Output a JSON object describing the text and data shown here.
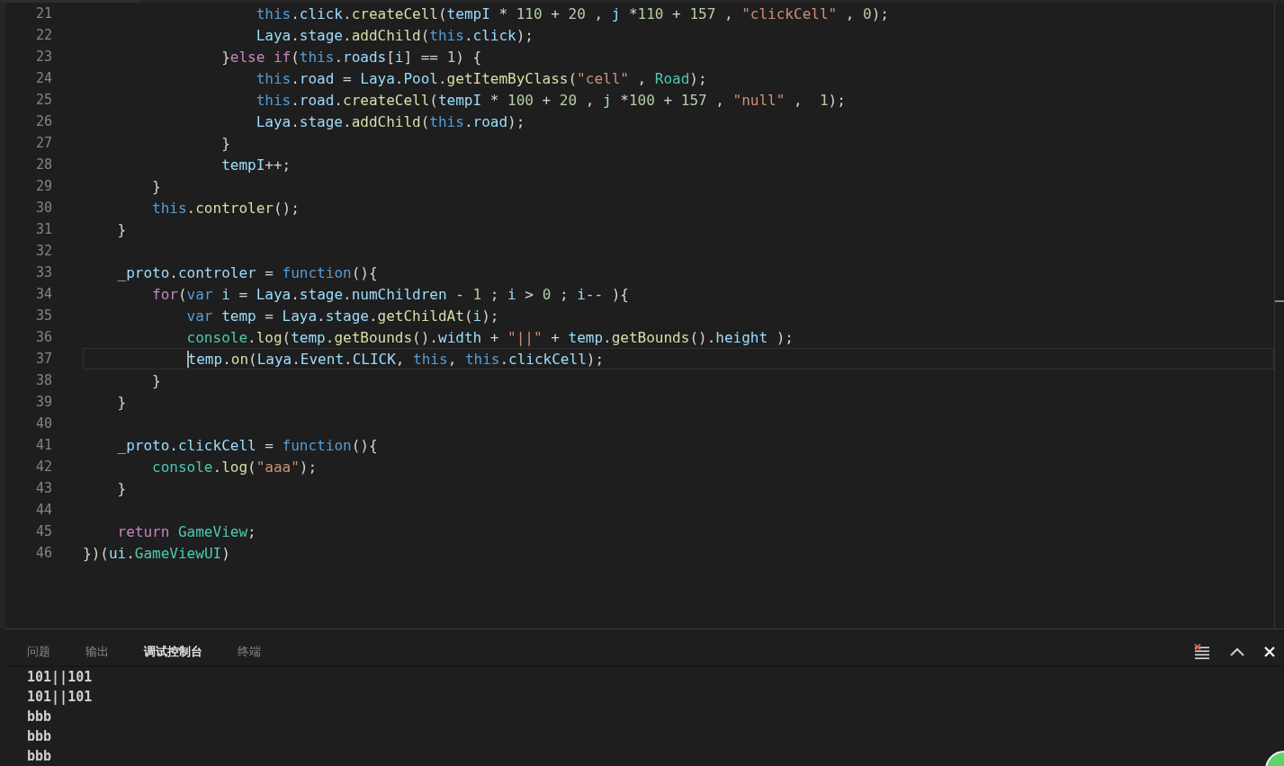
{
  "editor": {
    "lines": [
      {
        "number": "21",
        "current": false,
        "tokens": [
          {
            "kind": "kw",
            "t": "                    this"
          },
          {
            "kind": "p",
            "t": "."
          },
          {
            "kind": "var",
            "t": "click"
          },
          {
            "kind": "p",
            "t": "."
          },
          {
            "kind": "fn",
            "t": "createCell"
          },
          {
            "kind": "p",
            "t": "("
          },
          {
            "kind": "var",
            "t": "tempI"
          },
          {
            "kind": "p",
            "t": " * "
          },
          {
            "kind": "num",
            "t": "110"
          },
          {
            "kind": "p",
            "t": " + "
          },
          {
            "kind": "num",
            "t": "20"
          },
          {
            "kind": "p",
            "t": " , "
          },
          {
            "kind": "var",
            "t": "j"
          },
          {
            "kind": "p",
            "t": " *"
          },
          {
            "kind": "num",
            "t": "110"
          },
          {
            "kind": "p",
            "t": " + "
          },
          {
            "kind": "num",
            "t": "157"
          },
          {
            "kind": "p",
            "t": " , "
          },
          {
            "kind": "str",
            "t": "\"clickCell\""
          },
          {
            "kind": "p",
            "t": " , "
          },
          {
            "kind": "num",
            "t": "0"
          },
          {
            "kind": "p",
            "t": ");"
          }
        ]
      },
      {
        "number": "22",
        "current": false,
        "tokens": [
          {
            "kind": "var",
            "t": "                    Laya"
          },
          {
            "kind": "p",
            "t": "."
          },
          {
            "kind": "var",
            "t": "stage"
          },
          {
            "kind": "p",
            "t": "."
          },
          {
            "kind": "fn",
            "t": "addChild"
          },
          {
            "kind": "p",
            "t": "("
          },
          {
            "kind": "kw",
            "t": "this"
          },
          {
            "kind": "p",
            "t": "."
          },
          {
            "kind": "var",
            "t": "click"
          },
          {
            "kind": "p",
            "t": ");"
          }
        ]
      },
      {
        "number": "23",
        "current": false,
        "tokens": [
          {
            "kind": "p",
            "t": "                }"
          },
          {
            "kind": "ctl",
            "t": "else if"
          },
          {
            "kind": "p",
            "t": "("
          },
          {
            "kind": "kw",
            "t": "this"
          },
          {
            "kind": "p",
            "t": "."
          },
          {
            "kind": "var",
            "t": "roads"
          },
          {
            "kind": "p",
            "t": "["
          },
          {
            "kind": "var",
            "t": "i"
          },
          {
            "kind": "p",
            "t": "] == "
          },
          {
            "kind": "num",
            "t": "1"
          },
          {
            "kind": "p",
            "t": ") {"
          }
        ]
      },
      {
        "number": "24",
        "current": false,
        "tokens": [
          {
            "kind": "kw",
            "t": "                    this"
          },
          {
            "kind": "p",
            "t": "."
          },
          {
            "kind": "var",
            "t": "road"
          },
          {
            "kind": "p",
            "t": " = "
          },
          {
            "kind": "var",
            "t": "Laya"
          },
          {
            "kind": "p",
            "t": "."
          },
          {
            "kind": "var",
            "t": "Pool"
          },
          {
            "kind": "p",
            "t": "."
          },
          {
            "kind": "fn",
            "t": "getItemByClass"
          },
          {
            "kind": "p",
            "t": "("
          },
          {
            "kind": "str",
            "t": "\"cell\""
          },
          {
            "kind": "p",
            "t": " , "
          },
          {
            "kind": "type",
            "t": "Road"
          },
          {
            "kind": "p",
            "t": ");"
          }
        ]
      },
      {
        "number": "25",
        "current": false,
        "tokens": [
          {
            "kind": "kw",
            "t": "                    this"
          },
          {
            "kind": "p",
            "t": "."
          },
          {
            "kind": "var",
            "t": "road"
          },
          {
            "kind": "p",
            "t": "."
          },
          {
            "kind": "fn",
            "t": "createCell"
          },
          {
            "kind": "p",
            "t": "("
          },
          {
            "kind": "var",
            "t": "tempI"
          },
          {
            "kind": "p",
            "t": " * "
          },
          {
            "kind": "num",
            "t": "100"
          },
          {
            "kind": "p",
            "t": " + "
          },
          {
            "kind": "num",
            "t": "20"
          },
          {
            "kind": "p",
            "t": " , "
          },
          {
            "kind": "var",
            "t": "j"
          },
          {
            "kind": "p",
            "t": " *"
          },
          {
            "kind": "num",
            "t": "100"
          },
          {
            "kind": "p",
            "t": " + "
          },
          {
            "kind": "num",
            "t": "157"
          },
          {
            "kind": "p",
            "t": " , "
          },
          {
            "kind": "str",
            "t": "\"null\""
          },
          {
            "kind": "p",
            "t": " ,  "
          },
          {
            "kind": "num",
            "t": "1"
          },
          {
            "kind": "p",
            "t": ");"
          }
        ]
      },
      {
        "number": "26",
        "current": false,
        "tokens": [
          {
            "kind": "var",
            "t": "                    Laya"
          },
          {
            "kind": "p",
            "t": "."
          },
          {
            "kind": "var",
            "t": "stage"
          },
          {
            "kind": "p",
            "t": "."
          },
          {
            "kind": "fn",
            "t": "addChild"
          },
          {
            "kind": "p",
            "t": "("
          },
          {
            "kind": "kw",
            "t": "this"
          },
          {
            "kind": "p",
            "t": "."
          },
          {
            "kind": "var",
            "t": "road"
          },
          {
            "kind": "p",
            "t": ");"
          }
        ]
      },
      {
        "number": "27",
        "current": false,
        "tokens": [
          {
            "kind": "p",
            "t": "                }"
          }
        ]
      },
      {
        "number": "28",
        "current": false,
        "tokens": [
          {
            "kind": "var",
            "t": "                tempI"
          },
          {
            "kind": "p",
            "t": "++;"
          }
        ]
      },
      {
        "number": "29",
        "current": false,
        "tokens": [
          {
            "kind": "p",
            "t": "        }"
          }
        ]
      },
      {
        "number": "30",
        "current": false,
        "tokens": [
          {
            "kind": "kw",
            "t": "        this"
          },
          {
            "kind": "p",
            "t": "."
          },
          {
            "kind": "fn",
            "t": "controler"
          },
          {
            "kind": "p",
            "t": "();"
          }
        ]
      },
      {
        "number": "31",
        "current": false,
        "tokens": [
          {
            "kind": "p",
            "t": "    }"
          }
        ]
      },
      {
        "number": "32",
        "current": false
      },
      {
        "number": "33",
        "current": false,
        "tokens": [
          {
            "kind": "var",
            "t": "    _proto"
          },
          {
            "kind": "p",
            "t": "."
          },
          {
            "kind": "var",
            "t": "controler"
          },
          {
            "kind": "p",
            "t": " = "
          },
          {
            "kind": "kw",
            "t": "function"
          },
          {
            "kind": "p",
            "t": "(){"
          }
        ]
      },
      {
        "number": "34",
        "current": false,
        "tokens": [
          {
            "kind": "ctl",
            "t": "        for"
          },
          {
            "kind": "p",
            "t": "("
          },
          {
            "kind": "kw",
            "t": "var "
          },
          {
            "kind": "var",
            "t": "i"
          },
          {
            "kind": "p",
            "t": " = "
          },
          {
            "kind": "var",
            "t": "Laya"
          },
          {
            "kind": "p",
            "t": "."
          },
          {
            "kind": "var",
            "t": "stage"
          },
          {
            "kind": "p",
            "t": "."
          },
          {
            "kind": "var",
            "t": "numChildren"
          },
          {
            "kind": "p",
            "t": " - "
          },
          {
            "kind": "num",
            "t": "1"
          },
          {
            "kind": "p",
            "t": " ; "
          },
          {
            "kind": "var",
            "t": "i"
          },
          {
            "kind": "p",
            "t": " > "
          },
          {
            "kind": "num",
            "t": "0"
          },
          {
            "kind": "p",
            "t": " ; "
          },
          {
            "kind": "var",
            "t": "i"
          },
          {
            "kind": "p",
            "t": "-- ){"
          }
        ]
      },
      {
        "number": "35",
        "current": false,
        "tokens": [
          {
            "kind": "kw",
            "t": "            var "
          },
          {
            "kind": "var",
            "t": "temp"
          },
          {
            "kind": "p",
            "t": " = "
          },
          {
            "kind": "var",
            "t": "Laya"
          },
          {
            "kind": "p",
            "t": "."
          },
          {
            "kind": "var",
            "t": "stage"
          },
          {
            "kind": "p",
            "t": "."
          },
          {
            "kind": "fn",
            "t": "getChildAt"
          },
          {
            "kind": "p",
            "t": "("
          },
          {
            "kind": "var",
            "t": "i"
          },
          {
            "kind": "p",
            "t": ");"
          }
        ]
      },
      {
        "number": "36",
        "current": false,
        "tokens": [
          {
            "kind": "type",
            "t": "            console"
          },
          {
            "kind": "p",
            "t": "."
          },
          {
            "kind": "fn",
            "t": "log"
          },
          {
            "kind": "p",
            "t": "("
          },
          {
            "kind": "var",
            "t": "temp"
          },
          {
            "kind": "p",
            "t": "."
          },
          {
            "kind": "fn",
            "t": "getBounds"
          },
          {
            "kind": "p",
            "t": "()."
          },
          {
            "kind": "var",
            "t": "width"
          },
          {
            "kind": "p",
            "t": " + "
          },
          {
            "kind": "str",
            "t": "\"||\""
          },
          {
            "kind": "p",
            "t": " + "
          },
          {
            "kind": "var",
            "t": "temp"
          },
          {
            "kind": "p",
            "t": "."
          },
          {
            "kind": "fn",
            "t": "getBounds"
          },
          {
            "kind": "p",
            "t": "()."
          },
          {
            "kind": "var",
            "t": "height"
          },
          {
            "kind": "p",
            "t": " );"
          }
        ]
      },
      {
        "number": "37",
        "current": true,
        "tokens": [
          {
            "kind": "var",
            "t": "            temp"
          },
          {
            "kind": "p",
            "t": "."
          },
          {
            "kind": "fn",
            "t": "on"
          },
          {
            "kind": "p",
            "t": "("
          },
          {
            "kind": "var",
            "t": "Laya"
          },
          {
            "kind": "p",
            "t": "."
          },
          {
            "kind": "var",
            "t": "Event"
          },
          {
            "kind": "p",
            "t": "."
          },
          {
            "kind": "var",
            "t": "CLICK"
          },
          {
            "kind": "p",
            "t": ", "
          },
          {
            "kind": "kw",
            "t": "this"
          },
          {
            "kind": "p",
            "t": ", "
          },
          {
            "kind": "kw",
            "t": "this"
          },
          {
            "kind": "p",
            "t": "."
          },
          {
            "kind": "var",
            "t": "clickCell"
          },
          {
            "kind": "p",
            "t": ");"
          }
        ]
      },
      {
        "number": "38",
        "current": false,
        "tokens": [
          {
            "kind": "p",
            "t": "        }"
          }
        ]
      },
      {
        "number": "39",
        "current": false,
        "tokens": [
          {
            "kind": "p",
            "t": "    }"
          }
        ]
      },
      {
        "number": "40",
        "current": false
      },
      {
        "number": "41",
        "current": false,
        "tokens": [
          {
            "kind": "var",
            "t": "    _proto"
          },
          {
            "kind": "p",
            "t": "."
          },
          {
            "kind": "var",
            "t": "clickCell"
          },
          {
            "kind": "p",
            "t": " = "
          },
          {
            "kind": "kw",
            "t": "function"
          },
          {
            "kind": "p",
            "t": "(){"
          }
        ]
      },
      {
        "number": "42",
        "current": false,
        "tokens": [
          {
            "kind": "type",
            "t": "        console"
          },
          {
            "kind": "p",
            "t": "."
          },
          {
            "kind": "fn",
            "t": "log"
          },
          {
            "kind": "p",
            "t": "("
          },
          {
            "kind": "str",
            "t": "\"aaa\""
          },
          {
            "kind": "p",
            "t": ");"
          }
        ]
      },
      {
        "number": "43",
        "current": false,
        "tokens": [
          {
            "kind": "p",
            "t": "    }"
          }
        ]
      },
      {
        "number": "44",
        "current": false
      },
      {
        "number": "45",
        "current": false,
        "tokens": [
          {
            "kind": "ctl",
            "t": "    return "
          },
          {
            "kind": "type",
            "t": "GameView"
          },
          {
            "kind": "p",
            "t": ";"
          }
        ]
      },
      {
        "number": "46",
        "current": false,
        "tokens": [
          {
            "kind": "p",
            "t": "})("
          },
          {
            "kind": "var",
            "t": "ui"
          },
          {
            "kind": "p",
            "t": "."
          },
          {
            "kind": "type",
            "t": "GameViewUI"
          },
          {
            "kind": "p",
            "t": ")"
          }
        ]
      }
    ]
  },
  "panel": {
    "tabs": [
      {
        "label": "问题",
        "selected": false
      },
      {
        "label": "输出",
        "selected": false
      },
      {
        "label": "调试控制台",
        "selected": true
      },
      {
        "label": "终端",
        "selected": false
      }
    ],
    "console_lines": [
      "101||101",
      "101||101",
      "bbb",
      "bbb",
      "bbb"
    ]
  }
}
